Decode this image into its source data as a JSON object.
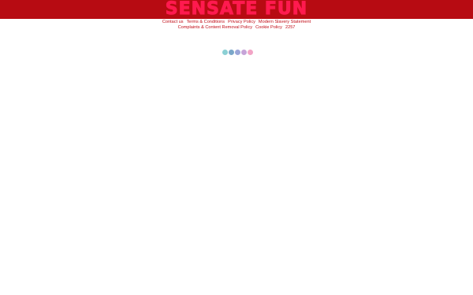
{
  "header": {
    "brand": "SENSATE FUN"
  },
  "footer": {
    "row1": [
      "Contact us",
      "Terms & Conditions",
      "Privacy Policy",
      "Modern Slavery Statement"
    ],
    "row2": [
      "Complaints & Content Removal Policy",
      "Cookie Policy",
      "2257"
    ]
  },
  "loader": {
    "dots": [
      "#8bd0d4",
      "#7aa7c9",
      "#9ba6d8",
      "#c6a4d8",
      "#f2a4c6"
    ]
  }
}
